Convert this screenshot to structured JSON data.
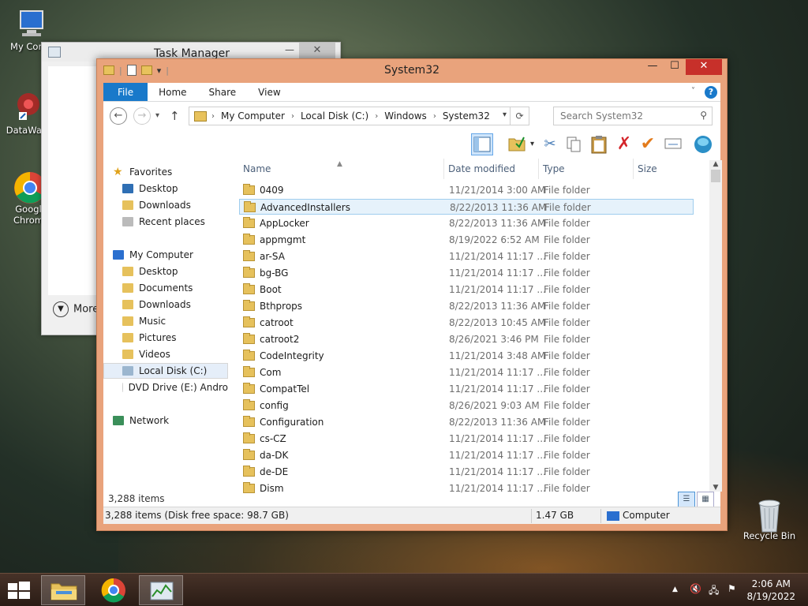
{
  "desktop": {
    "icons": [
      {
        "label": "My Comp"
      },
      {
        "label": "DataWag"
      },
      {
        "label": "Googl"
      },
      {
        "label": "Chrom"
      },
      {
        "label": "Recycle Bin"
      }
    ]
  },
  "task_manager": {
    "title": "Task Manager",
    "minimize": "—",
    "close": "✕",
    "more_label": "More"
  },
  "explorer": {
    "title": "System32",
    "window_buttons": {
      "minimize": "—",
      "maximize": "☐",
      "close": "✕"
    },
    "ribbon_tabs": [
      "File",
      "Home",
      "Share",
      "View"
    ],
    "help": "?",
    "address": {
      "crumbs": [
        "My Computer",
        "Local Disk (C:)",
        "Windows",
        "System32"
      ]
    },
    "search_placeholder": "Search System32",
    "nav": {
      "favorites": "Favorites",
      "fav_items": [
        "Desktop",
        "Downloads",
        "Recent places"
      ],
      "computer": "My Computer",
      "computer_items": [
        "Desktop",
        "Documents",
        "Downloads",
        "Music",
        "Pictures",
        "Videos",
        "Local Disk (C:)",
        "DVD Drive (E:) Andro"
      ],
      "network": "Network"
    },
    "columns": {
      "name": "Name",
      "date": "Date modified",
      "type": "Type",
      "size": "Size"
    },
    "files": [
      {
        "name": "0409",
        "date": "11/21/2014 3:00 AM",
        "type": "File folder"
      },
      {
        "name": "AdvancedInstallers",
        "date": "8/22/2013 11:36 AM",
        "type": "File folder"
      },
      {
        "name": "AppLocker",
        "date": "8/22/2013 11:36 AM",
        "type": "File folder"
      },
      {
        "name": "appmgmt",
        "date": "8/19/2022 6:52 AM",
        "type": "File folder"
      },
      {
        "name": "ar-SA",
        "date": "11/21/2014 11:17 ...",
        "type": "File folder"
      },
      {
        "name": "bg-BG",
        "date": "11/21/2014 11:17 ...",
        "type": "File folder"
      },
      {
        "name": "Boot",
        "date": "11/21/2014 11:17 ...",
        "type": "File folder"
      },
      {
        "name": "Bthprops",
        "date": "8/22/2013 11:36 AM",
        "type": "File folder"
      },
      {
        "name": "catroot",
        "date": "8/22/2013 10:45 AM",
        "type": "File folder"
      },
      {
        "name": "catroot2",
        "date": "8/26/2021 3:46 PM",
        "type": "File folder"
      },
      {
        "name": "CodeIntegrity",
        "date": "11/21/2014 3:48 AM",
        "type": "File folder"
      },
      {
        "name": "Com",
        "date": "11/21/2014 11:17 ...",
        "type": "File folder"
      },
      {
        "name": "CompatTel",
        "date": "11/21/2014 11:17 ...",
        "type": "File folder"
      },
      {
        "name": "config",
        "date": "8/26/2021 9:03 AM",
        "type": "File folder"
      },
      {
        "name": "Configuration",
        "date": "8/22/2013 11:36 AM",
        "type": "File folder"
      },
      {
        "name": "cs-CZ",
        "date": "11/21/2014 11:17 ...",
        "type": "File folder"
      },
      {
        "name": "da-DK",
        "date": "11/21/2014 11:17 ...",
        "type": "File folder"
      },
      {
        "name": "de-DE",
        "date": "11/21/2014 11:17 ...",
        "type": "File folder"
      },
      {
        "name": "Dism",
        "date": "11/21/2014 11:17 ...",
        "type": "File folder"
      }
    ],
    "item_count": "3,288 items",
    "status": {
      "left": "3,288 items (Disk free space: 98.7 GB)",
      "size": "1.47 GB",
      "location": "Computer"
    }
  },
  "taskbar": {
    "time": "2:06 AM",
    "date": "8/19/2022"
  },
  "colors": {
    "accent": "#1979ca",
    "window_frame": "#e9a37c",
    "close_red": "#c7302a"
  }
}
